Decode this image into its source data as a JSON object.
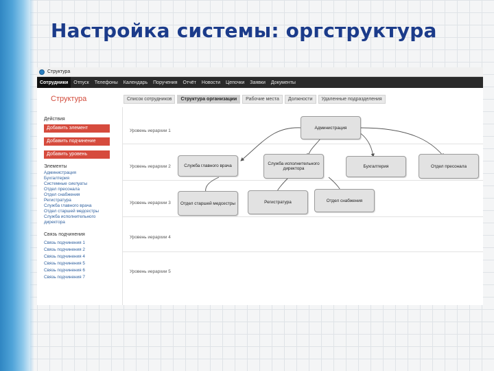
{
  "slide": {
    "title": "Настройка системы: оргструктура"
  },
  "window": {
    "title": "Структура"
  },
  "menu": [
    "Сотрудники",
    "Отпуск",
    "Телефоны",
    "Календарь",
    "Поручения",
    "Отчёт",
    "Новости",
    "Цепочки",
    "Заявки",
    "Документы"
  ],
  "page": {
    "title": "Структура",
    "tabs": [
      "Список сотрудников",
      "Структура организации",
      "Рабочие места",
      "Должности",
      "Удаленные подразделения"
    ],
    "active_tab": "Структура организации"
  },
  "sidebar": {
    "actions_heading": "Действия",
    "buttons": [
      "Добавить элемент",
      "Добавить подчинение",
      "Добавить уровень"
    ],
    "elements_heading": "Элементы",
    "elements": [
      "Администрация",
      "Бухгалтерия",
      "Системные сиклуаты",
      "Отдел пресонала",
      "Отдел снабжения",
      "Регистратура",
      "Служба главного врача",
      "Отдел старшей медсестры",
      "Служба исполнительного директора"
    ],
    "relations_heading": "Связь подчинения",
    "relations": [
      "Связь подчинения 1",
      "Связь подчинения 2",
      "Связь подчинения 4",
      "Связь подчинения 5",
      "Связь подчинения 6",
      "Связь подчинения 7"
    ]
  },
  "levels": [
    "Уровень иерархии 1",
    "Уровень иерархии 2",
    "Уровень иерархии 3",
    "Уровень иерархии 4",
    "Уровень иерархии 5"
  ],
  "nodes": {
    "admin": "Администрация",
    "chief": "Служба главного врача",
    "director": "Служба исполнительного директора",
    "accounting": "Бухгалтерия",
    "personnel": "Отдел пресонала",
    "nurse": "Отдел старшей медсестры",
    "registry": "Регистратура",
    "supply": "Отдел снабжения"
  },
  "colors": {
    "slide_title": "#1b3b8a",
    "accent_red": "#d64b3d",
    "link_blue": "#2d5f9e",
    "menubar": "#2a2a2a"
  }
}
